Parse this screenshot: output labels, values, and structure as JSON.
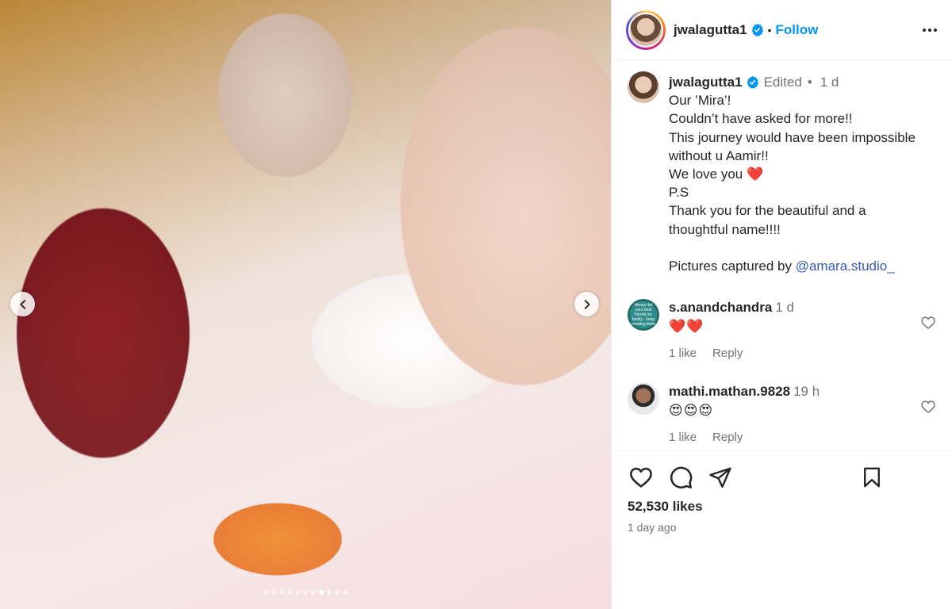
{
  "post": {
    "username": "jwalagutta1",
    "follow_label": "Follow",
    "separator": "•",
    "carousel": {
      "dot_count": 11,
      "active_index": 7
    }
  },
  "caption": {
    "username": "jwalagutta1",
    "edited": "Edited",
    "separator": "•",
    "time": "1 d",
    "lines": [
      "Our ’Mira’!",
      "Couldn’t have asked for more!!",
      "This journey would have been impossible",
      "without u Aamir!!",
      "We love you ❤️",
      "P.S",
      "Thank you for the beautiful and a",
      "thoughtful name!!!!",
      "",
      "Pictures captured by "
    ],
    "mention": "@amara.studio_"
  },
  "comments": [
    {
      "username": "s.anandchandra",
      "time": "1 d",
      "text": "❤️❤️",
      "likes": "1 like",
      "reply": "Reply",
      "avatar_text": "Always let your best friends be family - keep creating them"
    },
    {
      "username": "mathi.mathan.9828",
      "time": "19 h",
      "text": "😍😍😍",
      "likes": "1 like",
      "reply": "Reply"
    }
  ],
  "footer": {
    "likes": "52,530 likes",
    "time_ago": "1 day ago"
  },
  "icons": {
    "like": "heart-icon",
    "comment": "comment-icon",
    "share": "share-icon",
    "save": "bookmark-icon",
    "more": "more-icon",
    "verified": "verified-badge-icon"
  },
  "colors": {
    "link": "#0095f6",
    "mention": "#3557b7",
    "muted": "#737373",
    "verified": "#0095f6"
  }
}
